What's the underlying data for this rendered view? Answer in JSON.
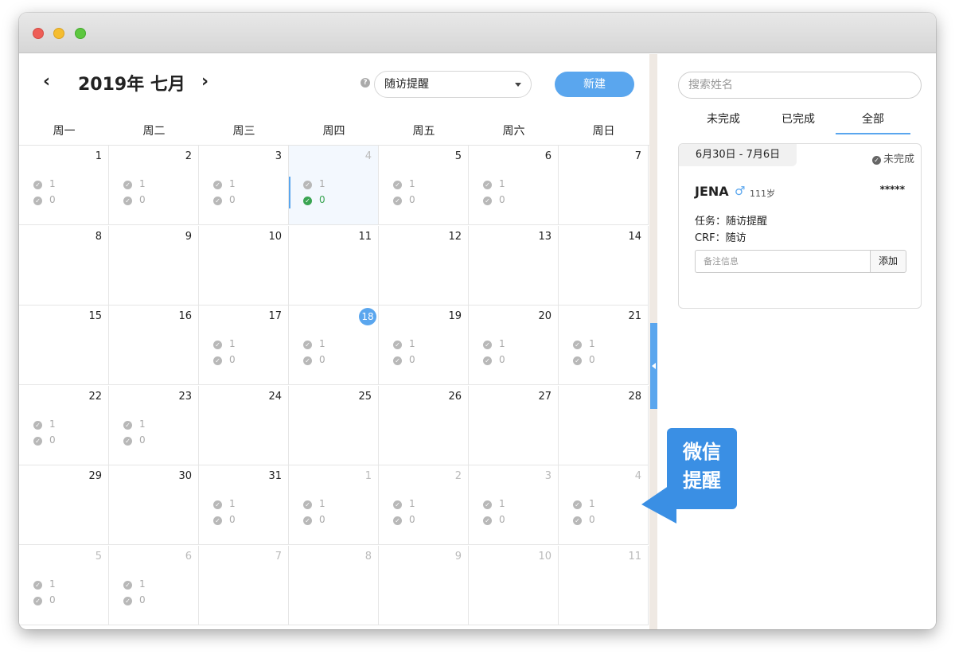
{
  "header": {
    "prev_icon": "‹",
    "next_icon": "›",
    "month_title": "2019年 七月",
    "help_icon": "?",
    "filter_selected": "随访提醒",
    "new_button": "新建"
  },
  "weekdays": [
    "周一",
    "周二",
    "周三",
    "周四",
    "周五",
    "周六",
    "周日"
  ],
  "calendar": {
    "weeks": [
      [
        {
          "day": "1",
          "other": false,
          "stats": [
            "1",
            "0"
          ]
        },
        {
          "day": "2",
          "other": false,
          "stats": [
            "1",
            "0"
          ]
        },
        {
          "day": "3",
          "other": false,
          "stats": [
            "1",
            "0"
          ]
        },
        {
          "day": "4",
          "other": true,
          "stats": [
            "1",
            "0"
          ],
          "selected": true,
          "done_green": true
        },
        {
          "day": "5",
          "other": false,
          "stats": [
            "1",
            "0"
          ]
        },
        {
          "day": "6",
          "other": false,
          "stats": [
            "1",
            "0"
          ]
        },
        {
          "day": "7",
          "other": false,
          "stats": []
        }
      ],
      [
        {
          "day": "8",
          "other": false,
          "stats": []
        },
        {
          "day": "9",
          "other": false,
          "stats": []
        },
        {
          "day": "10",
          "other": false,
          "stats": []
        },
        {
          "day": "11",
          "other": false,
          "stats": []
        },
        {
          "day": "12",
          "other": false,
          "stats": []
        },
        {
          "day": "13",
          "other": false,
          "stats": []
        },
        {
          "day": "14",
          "other": false,
          "stats": []
        }
      ],
      [
        {
          "day": "15",
          "other": false,
          "stats": []
        },
        {
          "day": "16",
          "other": false,
          "stats": []
        },
        {
          "day": "17",
          "other": false,
          "stats": [
            "1",
            "0"
          ]
        },
        {
          "day": "18",
          "other": false,
          "stats": [
            "1",
            "0"
          ],
          "today": true
        },
        {
          "day": "19",
          "other": false,
          "stats": [
            "1",
            "0"
          ]
        },
        {
          "day": "20",
          "other": false,
          "stats": [
            "1",
            "0"
          ]
        },
        {
          "day": "21",
          "other": false,
          "stats": [
            "1",
            "0"
          ]
        }
      ],
      [
        {
          "day": "22",
          "other": false,
          "stats": [
            "1",
            "0"
          ]
        },
        {
          "day": "23",
          "other": false,
          "stats": [
            "1",
            "0"
          ]
        },
        {
          "day": "24",
          "other": false,
          "stats": []
        },
        {
          "day": "25",
          "other": false,
          "stats": []
        },
        {
          "day": "26",
          "other": false,
          "stats": []
        },
        {
          "day": "27",
          "other": false,
          "stats": []
        },
        {
          "day": "28",
          "other": false,
          "stats": []
        }
      ],
      [
        {
          "day": "29",
          "other": false,
          "stats": []
        },
        {
          "day": "30",
          "other": false,
          "stats": []
        },
        {
          "day": "31",
          "other": false,
          "stats": [
            "1",
            "0"
          ]
        },
        {
          "day": "1",
          "other": true,
          "stats": [
            "1",
            "0"
          ]
        },
        {
          "day": "2",
          "other": true,
          "stats": [
            "1",
            "0"
          ]
        },
        {
          "day": "3",
          "other": true,
          "stats": [
            "1",
            "0"
          ]
        },
        {
          "day": "4",
          "other": true,
          "stats": [
            "1",
            "0"
          ]
        }
      ],
      [
        {
          "day": "5",
          "other": true,
          "stats": [
            "1",
            "0"
          ]
        },
        {
          "day": "6",
          "other": true,
          "stats": [
            "1",
            "0"
          ]
        },
        {
          "day": "7",
          "other": true,
          "stats": []
        },
        {
          "day": "8",
          "other": true,
          "stats": []
        },
        {
          "day": "9",
          "other": true,
          "stats": []
        },
        {
          "day": "10",
          "other": true,
          "stats": []
        },
        {
          "day": "11",
          "other": true,
          "stats": []
        }
      ]
    ]
  },
  "sidebar": {
    "search_placeholder": "搜索姓名",
    "tabs": [
      "未完成",
      "已完成",
      "全部"
    ],
    "active_tab": 2,
    "card": {
      "week_range": "6月30日 - 7月6日",
      "status": "未完成",
      "patient_name": "JENA",
      "gender_icon": "♂",
      "age": "111岁",
      "stars": "*****",
      "task": "任务：随访提醒",
      "crf": "CRF：随访",
      "note_placeholder": "备注信息",
      "add_button": "添加"
    }
  },
  "callout": {
    "line1": "微信",
    "line2": "提醒"
  },
  "colors": {
    "accent": "#5aa6ee",
    "callout": "#3a8fe4",
    "done_green": "#3aa452"
  }
}
